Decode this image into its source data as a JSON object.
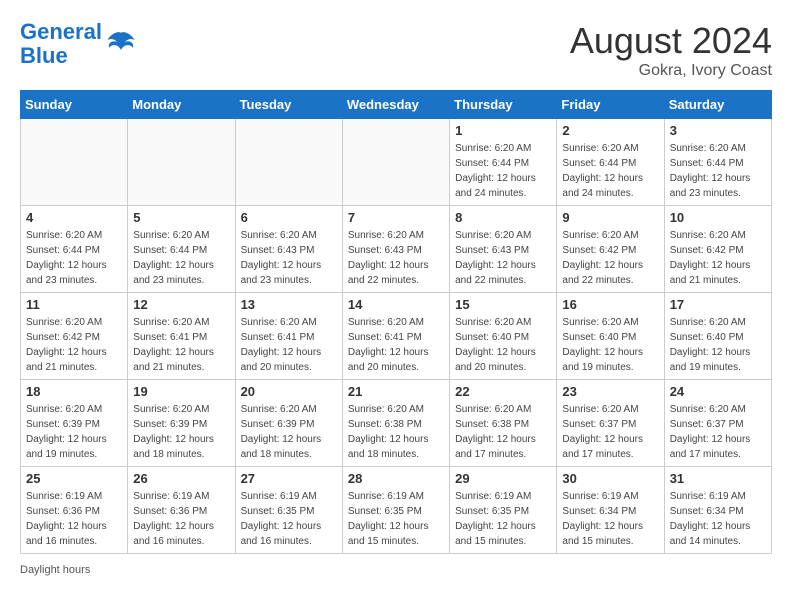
{
  "header": {
    "logo_line1": "General",
    "logo_line2": "Blue",
    "month": "August 2024",
    "location": "Gokra, Ivory Coast"
  },
  "days_of_week": [
    "Sunday",
    "Monday",
    "Tuesday",
    "Wednesday",
    "Thursday",
    "Friday",
    "Saturday"
  ],
  "weeks": [
    [
      {
        "day": "",
        "detail": ""
      },
      {
        "day": "",
        "detail": ""
      },
      {
        "day": "",
        "detail": ""
      },
      {
        "day": "",
        "detail": ""
      },
      {
        "day": "1",
        "detail": "Sunrise: 6:20 AM\nSunset: 6:44 PM\nDaylight: 12 hours\nand 24 minutes."
      },
      {
        "day": "2",
        "detail": "Sunrise: 6:20 AM\nSunset: 6:44 PM\nDaylight: 12 hours\nand 24 minutes."
      },
      {
        "day": "3",
        "detail": "Sunrise: 6:20 AM\nSunset: 6:44 PM\nDaylight: 12 hours\nand 23 minutes."
      }
    ],
    [
      {
        "day": "4",
        "detail": "Sunrise: 6:20 AM\nSunset: 6:44 PM\nDaylight: 12 hours\nand 23 minutes."
      },
      {
        "day": "5",
        "detail": "Sunrise: 6:20 AM\nSunset: 6:44 PM\nDaylight: 12 hours\nand 23 minutes."
      },
      {
        "day": "6",
        "detail": "Sunrise: 6:20 AM\nSunset: 6:43 PM\nDaylight: 12 hours\nand 23 minutes."
      },
      {
        "day": "7",
        "detail": "Sunrise: 6:20 AM\nSunset: 6:43 PM\nDaylight: 12 hours\nand 22 minutes."
      },
      {
        "day": "8",
        "detail": "Sunrise: 6:20 AM\nSunset: 6:43 PM\nDaylight: 12 hours\nand 22 minutes."
      },
      {
        "day": "9",
        "detail": "Sunrise: 6:20 AM\nSunset: 6:42 PM\nDaylight: 12 hours\nand 22 minutes."
      },
      {
        "day": "10",
        "detail": "Sunrise: 6:20 AM\nSunset: 6:42 PM\nDaylight: 12 hours\nand 21 minutes."
      }
    ],
    [
      {
        "day": "11",
        "detail": "Sunrise: 6:20 AM\nSunset: 6:42 PM\nDaylight: 12 hours\nand 21 minutes."
      },
      {
        "day": "12",
        "detail": "Sunrise: 6:20 AM\nSunset: 6:41 PM\nDaylight: 12 hours\nand 21 minutes."
      },
      {
        "day": "13",
        "detail": "Sunrise: 6:20 AM\nSunset: 6:41 PM\nDaylight: 12 hours\nand 20 minutes."
      },
      {
        "day": "14",
        "detail": "Sunrise: 6:20 AM\nSunset: 6:41 PM\nDaylight: 12 hours\nand 20 minutes."
      },
      {
        "day": "15",
        "detail": "Sunrise: 6:20 AM\nSunset: 6:40 PM\nDaylight: 12 hours\nand 20 minutes."
      },
      {
        "day": "16",
        "detail": "Sunrise: 6:20 AM\nSunset: 6:40 PM\nDaylight: 12 hours\nand 19 minutes."
      },
      {
        "day": "17",
        "detail": "Sunrise: 6:20 AM\nSunset: 6:40 PM\nDaylight: 12 hours\nand 19 minutes."
      }
    ],
    [
      {
        "day": "18",
        "detail": "Sunrise: 6:20 AM\nSunset: 6:39 PM\nDaylight: 12 hours\nand 19 minutes."
      },
      {
        "day": "19",
        "detail": "Sunrise: 6:20 AM\nSunset: 6:39 PM\nDaylight: 12 hours\nand 18 minutes."
      },
      {
        "day": "20",
        "detail": "Sunrise: 6:20 AM\nSunset: 6:39 PM\nDaylight: 12 hours\nand 18 minutes."
      },
      {
        "day": "21",
        "detail": "Sunrise: 6:20 AM\nSunset: 6:38 PM\nDaylight: 12 hours\nand 18 minutes."
      },
      {
        "day": "22",
        "detail": "Sunrise: 6:20 AM\nSunset: 6:38 PM\nDaylight: 12 hours\nand 17 minutes."
      },
      {
        "day": "23",
        "detail": "Sunrise: 6:20 AM\nSunset: 6:37 PM\nDaylight: 12 hours\nand 17 minutes."
      },
      {
        "day": "24",
        "detail": "Sunrise: 6:20 AM\nSunset: 6:37 PM\nDaylight: 12 hours\nand 17 minutes."
      }
    ],
    [
      {
        "day": "25",
        "detail": "Sunrise: 6:19 AM\nSunset: 6:36 PM\nDaylight: 12 hours\nand 16 minutes."
      },
      {
        "day": "26",
        "detail": "Sunrise: 6:19 AM\nSunset: 6:36 PM\nDaylight: 12 hours\nand 16 minutes."
      },
      {
        "day": "27",
        "detail": "Sunrise: 6:19 AM\nSunset: 6:35 PM\nDaylight: 12 hours\nand 16 minutes."
      },
      {
        "day": "28",
        "detail": "Sunrise: 6:19 AM\nSunset: 6:35 PM\nDaylight: 12 hours\nand 15 minutes."
      },
      {
        "day": "29",
        "detail": "Sunrise: 6:19 AM\nSunset: 6:35 PM\nDaylight: 12 hours\nand 15 minutes."
      },
      {
        "day": "30",
        "detail": "Sunrise: 6:19 AM\nSunset: 6:34 PM\nDaylight: 12 hours\nand 15 minutes."
      },
      {
        "day": "31",
        "detail": "Sunrise: 6:19 AM\nSunset: 6:34 PM\nDaylight: 12 hours\nand 14 minutes."
      }
    ]
  ],
  "footer": {
    "text": "Daylight hours"
  }
}
